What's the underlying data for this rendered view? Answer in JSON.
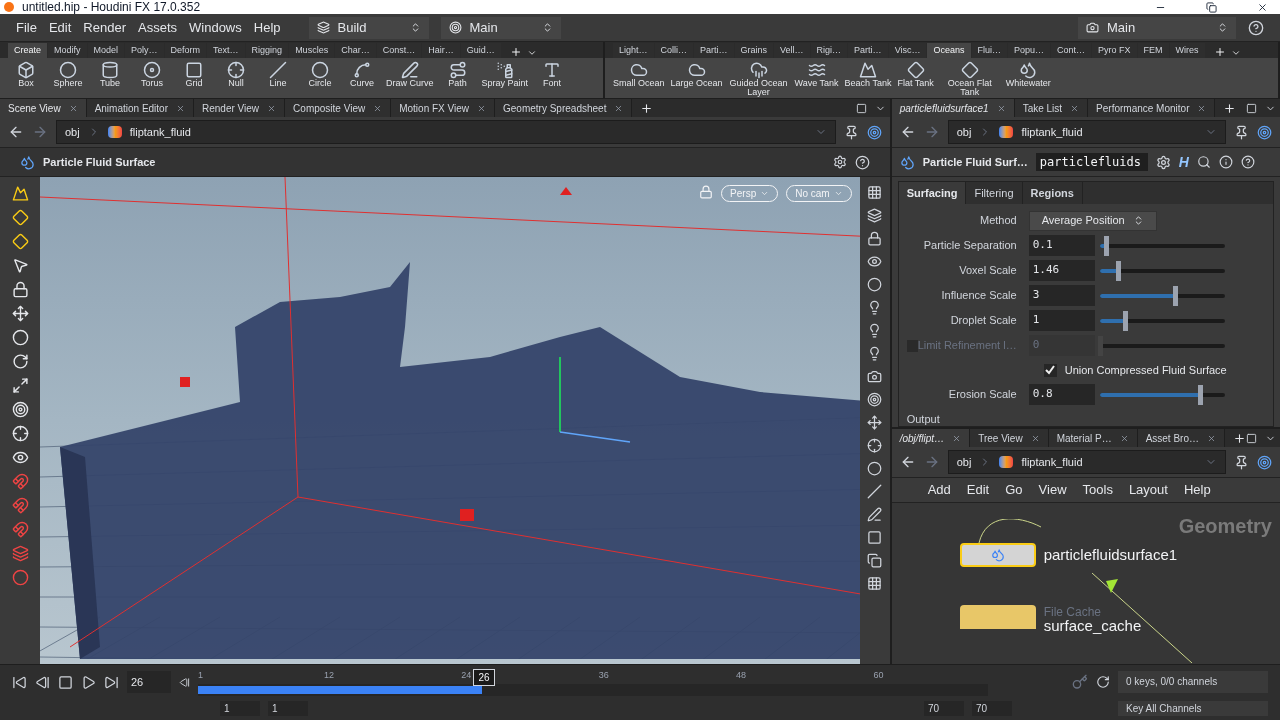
{
  "window": {
    "title": "untitled.hip - Houdini FX 17.0.352"
  },
  "menu": [
    "File",
    "Edit",
    "Render",
    "Assets",
    "Windows",
    "Help"
  ],
  "desktop": "Build",
  "context": "Main",
  "right_context": "Main",
  "shelf_left": {
    "tabs": [
      {
        "label": "Create",
        "selected": true
      },
      {
        "label": "Modify",
        "selected": false
      },
      {
        "label": "Model",
        "selected": false
      },
      {
        "label": "Poly…",
        "selected": false
      },
      {
        "label": "Deform",
        "selected": false
      },
      {
        "label": "Text…",
        "selected": false
      },
      {
        "label": "Rigging",
        "selected": false
      },
      {
        "label": "Muscles",
        "selected": false
      },
      {
        "label": "Char…",
        "selected": false
      },
      {
        "label": "Const…",
        "selected": false
      },
      {
        "label": "Hair…",
        "selected": false
      },
      {
        "label": "Guid…",
        "selected": false
      }
    ],
    "tools": [
      "Box",
      "Sphere",
      "Tube",
      "Torus",
      "Grid",
      "Null",
      "Line",
      "Circle",
      "Curve",
      "Draw Curve",
      "Path",
      "Spray Paint",
      "Font"
    ]
  },
  "shelf_right": {
    "tabs": [
      {
        "label": "Light…",
        "selected": false
      },
      {
        "label": "Colli…",
        "selected": false
      },
      {
        "label": "Parti…",
        "selected": false
      },
      {
        "label": "Grains",
        "selected": false
      },
      {
        "label": "Vell…",
        "selected": false
      },
      {
        "label": "Rigi…",
        "selected": false
      },
      {
        "label": "Parti…",
        "selected": false
      },
      {
        "label": "Visc…",
        "selected": false
      },
      {
        "label": "Oceans",
        "selected": true
      },
      {
        "label": "Flui…",
        "selected": false
      },
      {
        "label": "Popu…",
        "selected": false
      },
      {
        "label": "Cont…",
        "selected": false
      },
      {
        "label": "Pyro FX",
        "selected": false
      },
      {
        "label": "FEM",
        "selected": false
      },
      {
        "label": "Wires",
        "selected": false
      }
    ],
    "tools": [
      "Small Ocean",
      "Large Ocean",
      "Guided Ocean Layer",
      "Wave Tank",
      "Beach Tank",
      "Flat Tank",
      "Ocean Flat Tank",
      "Whitewater"
    ]
  },
  "scene_tabs": [
    {
      "label": "Scene View",
      "selected": true
    },
    {
      "label": "Animation Editor",
      "selected": false
    },
    {
      "label": "Render View",
      "selected": false
    },
    {
      "label": "Composite View",
      "selected": false
    },
    {
      "label": "Motion FX View",
      "selected": false
    },
    {
      "label": "Geometry Spreadsheet",
      "selected": false
    }
  ],
  "scene_path": {
    "root": "obj",
    "node": "fliptank_fluid"
  },
  "viewport": {
    "title": "Particle Fluid Surface",
    "camera": "Persp",
    "cam_menu": "No cam"
  },
  "param_tabs": [
    {
      "label": "particlefluidsurface1",
      "selected": true
    },
    {
      "label": "Take List",
      "selected": false
    },
    {
      "label": "Performance Monitor",
      "selected": false
    }
  ],
  "param_path": {
    "root": "obj",
    "node": "fliptank_fluid"
  },
  "node_header": {
    "type": "Particle Fluid Surf…",
    "name": "particlefluids",
    "h_button": "H"
  },
  "node_tabs": [
    {
      "label": "Surfacing",
      "selected": true
    },
    {
      "label": "Filtering",
      "selected": false
    },
    {
      "label": "Regions",
      "selected": false
    }
  ],
  "params": [
    {
      "kind": "menu",
      "label": "Method",
      "value": "Average Position"
    },
    {
      "kind": "slider",
      "label": "Particle Separation",
      "value": "0.1",
      "level": 0.05,
      "disabled": false
    },
    {
      "kind": "slider",
      "label": "Voxel Scale",
      "value": "1.46",
      "level": 0.15,
      "disabled": false
    },
    {
      "kind": "slider",
      "label": "Influence Scale",
      "value": "3",
      "level": 0.6,
      "disabled": false
    },
    {
      "kind": "slider",
      "label": "Droplet Scale",
      "value": "1",
      "level": 0.2,
      "disabled": false
    },
    {
      "kind": "slider",
      "label": "Limit Refinement l…",
      "value": "0",
      "level": 0,
      "disabled": true,
      "checked": false
    },
    {
      "kind": "toggle",
      "label": "Union Compressed Fluid Surface",
      "checked": true
    },
    {
      "kind": "slider",
      "label": "Erosion Scale",
      "value": "0.8",
      "level": 0.8,
      "disabled": false
    },
    {
      "kind": "section",
      "label": "Output"
    }
  ],
  "network_tabs": [
    {
      "label": "/obj/flipt…",
      "selected": true
    },
    {
      "label": "Tree View",
      "selected": false
    },
    {
      "label": "Material P…",
      "selected": false
    },
    {
      "label": "Asset Bro…",
      "selected": false
    }
  ],
  "network_path": {
    "root": "obj",
    "node": "fliptank_fluid"
  },
  "network_menu": [
    "Add",
    "Edit",
    "Go",
    "View",
    "Tools",
    "Layout",
    "Help"
  ],
  "network": {
    "context_label": "Geometry",
    "nodes": [
      {
        "name": "particlefluidsurface1",
        "selected": true
      },
      {
        "type": "File Cache",
        "name": "surface_cache",
        "selected": false
      }
    ]
  },
  "timeline": {
    "frame": "26",
    "ticks": [
      "1",
      "12",
      "24",
      "36",
      "48",
      "60"
    ],
    "marker": "26",
    "level": 0.36,
    "start": "1",
    "start2": "1",
    "end": "70",
    "end2": "70",
    "keys": "0 keys, 0/0 channels",
    "key_all": "Key All Channels"
  }
}
